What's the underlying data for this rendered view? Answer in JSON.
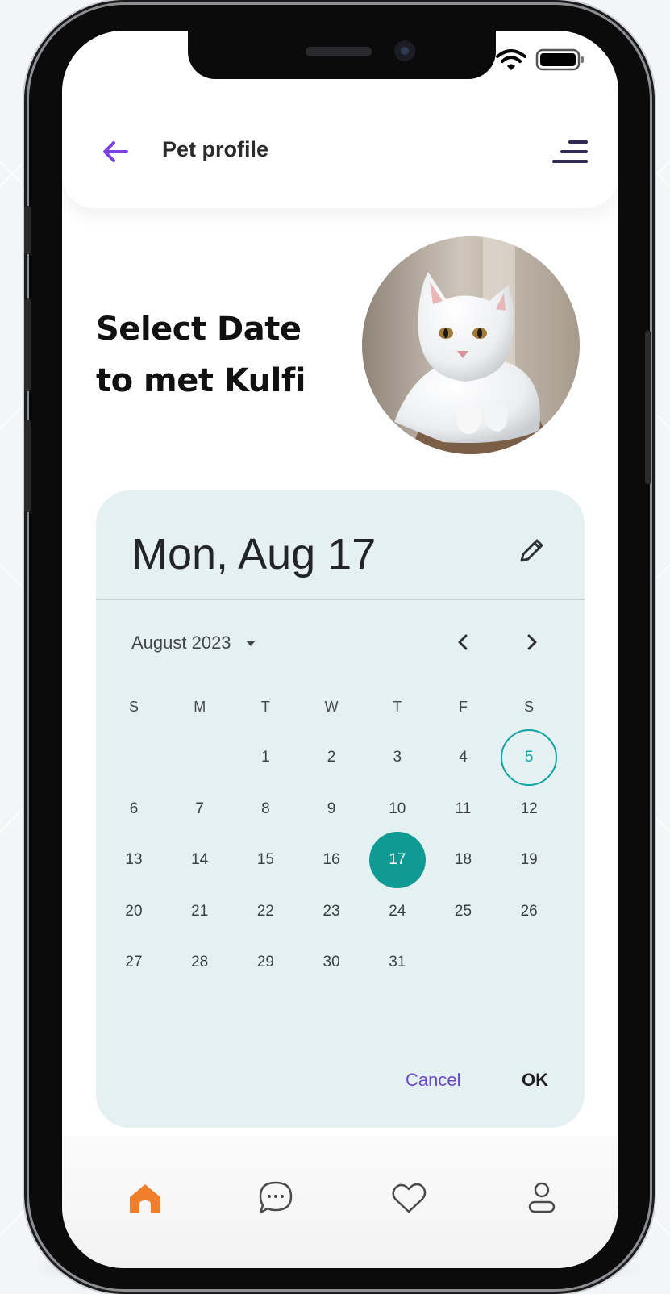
{
  "header": {
    "title": "Pet profile",
    "back_icon": "arrow-left-icon",
    "menu_icon": "menu-lines-icon",
    "accent_color": "#7b3fe4"
  },
  "status_bar": {
    "wifi_icon": "wifi-icon",
    "battery_icon": "battery-icon"
  },
  "hero": {
    "line1": "Select Date",
    "line2": "to met Kulfi",
    "pet_photo": "white-cat-photo"
  },
  "picker": {
    "selected_display": "Mon, Aug 17",
    "edit_icon": "pencil-icon",
    "month_label": "August 2023",
    "prev_icon": "chevron-left-icon",
    "next_icon": "chevron-right-icon",
    "weekdays": [
      "S",
      "M",
      "T",
      "W",
      "T",
      "F",
      "S"
    ],
    "first_weekday_index": 2,
    "days_in_month": 31,
    "today": "5",
    "selected": "17",
    "today_color": "#0ea5a0",
    "selected_color": "#0f9a93",
    "background_color": "#e5f0f3",
    "cancel_label": "Cancel",
    "ok_label": "OK"
  },
  "bottom_nav": {
    "items": [
      {
        "icon": "home-icon",
        "active": true
      },
      {
        "icon": "chat-icon",
        "active": false
      },
      {
        "icon": "heart-icon",
        "active": false
      },
      {
        "icon": "profile-icon",
        "active": false
      }
    ],
    "active_color": "#f07f2d"
  }
}
